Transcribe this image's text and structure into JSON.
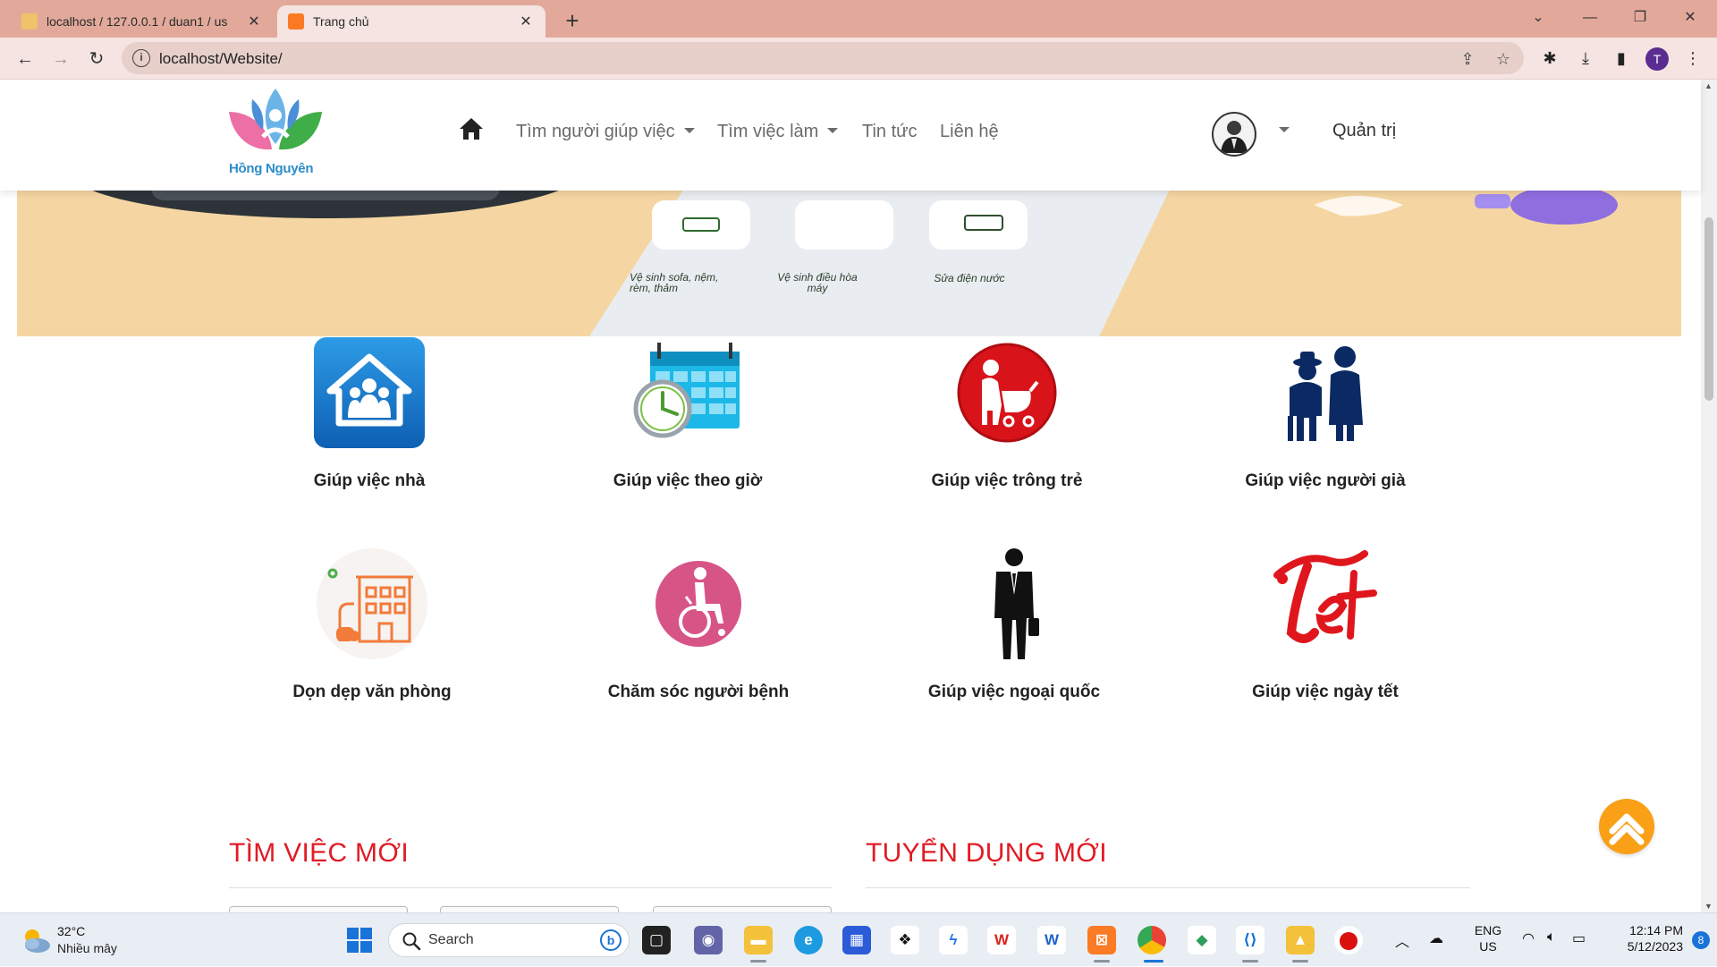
{
  "browser": {
    "tabs": [
      {
        "title": "localhost / 127.0.0.1 / duan1 / us",
        "active": false
      },
      {
        "title": "Trang chủ",
        "active": true
      }
    ],
    "url": "localhost/Website/",
    "profile_initial": "T"
  },
  "site": {
    "logo_text": "Hồng Nguyên",
    "nav": [
      {
        "label": "Tìm người giúp việc",
        "dropdown": true
      },
      {
        "label": "Tìm việc làm",
        "dropdown": true
      },
      {
        "label": "Tin tức",
        "dropdown": false
      },
      {
        "label": "Liên hệ",
        "dropdown": false
      }
    ],
    "admin_label": "Quản trị",
    "banner_texts": [
      "Vệ sinh sofa, nệm, rèm, thảm",
      "Vệ sinh điều hòa máy",
      "Sửa điện nước"
    ],
    "services": [
      {
        "label": "Giúp việc nhà",
        "icon": "house-family-icon"
      },
      {
        "label": "Giúp việc theo giờ",
        "icon": "calendar-clock-icon"
      },
      {
        "label": "Giúp việc trông trẻ",
        "icon": "babysitter-icon"
      },
      {
        "label": "Giúp việc người già",
        "icon": "elderly-couple-icon"
      },
      {
        "label": "Dọn dẹp văn phòng",
        "icon": "office-cleaning-icon"
      },
      {
        "label": "Chăm sóc người bệnh",
        "icon": "wheelchair-icon"
      },
      {
        "label": "Giúp việc ngoại quốc",
        "icon": "businessman-icon"
      },
      {
        "label": "Giúp việc ngày tết",
        "icon": "tet-icon"
      }
    ],
    "sections": {
      "jobs_title": "TÌM VIỆC MỚI",
      "recruit_title": "TUYỂN DỤNG MỚI"
    },
    "colors": {
      "accent_red": "#e01b24",
      "scroll_top": "#f9a017"
    }
  },
  "taskbar": {
    "weather_temp": "32°C",
    "weather_condition": "Nhiều mây",
    "search_placeholder": "Search",
    "language": "ENG",
    "region": "US",
    "time": "12:14 PM",
    "date": "5/12/2023",
    "notification_count": "8"
  }
}
